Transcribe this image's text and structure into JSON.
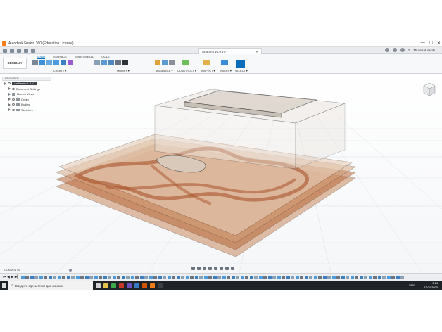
{
  "window": {
    "title": "Autodesk Fusion 360 (Education License)",
    "controls": [
      "—",
      "☐",
      "✕"
    ]
  },
  "tabbar": {
    "doc_tab": "AntFarm v1.0 v7*",
    "doc_tab_close": "✕",
    "user": "Zhurenat Vasily",
    "help": "?"
  },
  "ribbon": {
    "workspace": "DESIGN ▾",
    "tabs": [
      "SOLID",
      "SURFACE",
      "SHEET METAL",
      "TOOLS"
    ],
    "groups": [
      "CREATE ▾",
      "MODIFY ▾",
      "ASSEMBLE ▾",
      "CONSTRUCT ▾",
      "INSPECT ▾",
      "INSERT ▾",
      "SELECT ▾"
    ]
  },
  "browser": {
    "header": "BROWSER",
    "root": "AntFarm v1.0 v7",
    "items": [
      "Document Settings",
      "Named Views",
      "Origin",
      "Bodies",
      "Sketches"
    ]
  },
  "comments": {
    "label": "COMMENTS"
  },
  "taskbar": {
    "search_placeholder": "Введите здесь текст для поиска",
    "lang": "ENG",
    "time": "9:14",
    "date": "22.04.2020"
  },
  "colors": {
    "accent": "#0a6ebd",
    "wood": "#b86a3a",
    "fusion_orange": "#f07d1a"
  }
}
